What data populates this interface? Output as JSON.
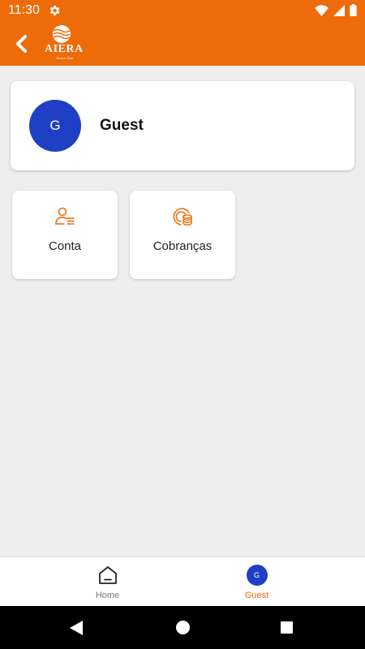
{
  "status_bar": {
    "time": "11:30",
    "icons": [
      "settings-gear-icon",
      "wifi-icon",
      "cell-signal-icon",
      "battery-icon"
    ]
  },
  "app_bar": {
    "back_icon": "chevron-left-icon",
    "logo_text": "AIERA",
    "logo_subtext": "Beach Club"
  },
  "profile": {
    "avatar_initial": "G",
    "name": "Guest"
  },
  "tiles": [
    {
      "label": "Conta",
      "icon": "account-list-icon"
    },
    {
      "label": "Cobranças",
      "icon": "coins-icon"
    }
  ],
  "bottom_nav": {
    "items": [
      {
        "label": "Home",
        "icon": "home-icon",
        "active": false
      },
      {
        "label": "Guest",
        "avatar_initial": "G",
        "active": true
      }
    ]
  },
  "colors": {
    "brand_orange": "#ee6b0a",
    "avatar_blue": "#1f3fc4",
    "background": "#eeeeee"
  }
}
